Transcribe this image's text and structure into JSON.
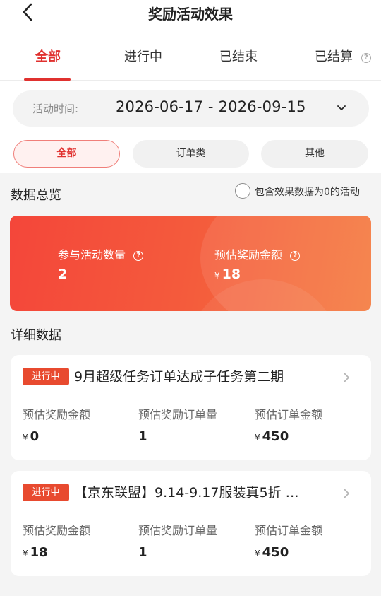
{
  "nav": {
    "title": "奖励活动效果"
  },
  "tabs": [
    {
      "label": "全部"
    },
    {
      "label": "进行中"
    },
    {
      "label": "已结束"
    },
    {
      "label": "已结算"
    }
  ],
  "date_filter": {
    "label": "活动时间:",
    "value": "2026-06-17 - 2026-09-15"
  },
  "type_filters": [
    {
      "label": "全部"
    },
    {
      "label": "订单类"
    },
    {
      "label": "其他"
    }
  ],
  "overview": {
    "title": "数据总览",
    "include_zero_label": "包含效果数据为0的活动",
    "metrics": [
      {
        "label": "参与活动数量",
        "value": "2"
      },
      {
        "label": "预估奖励金额",
        "currency": "¥",
        "value": "18"
      }
    ]
  },
  "details": {
    "title": "详细数据",
    "cards": [
      {
        "status": "进行中",
        "title": "9月超级任务订单达成子任务第二期",
        "metrics": [
          {
            "label": "预估奖励金额",
            "currency": "¥",
            "value": "0"
          },
          {
            "label": "预估奖励订单量",
            "value": "1"
          },
          {
            "label": "预估订单金额",
            "currency": "¥",
            "value": "450"
          }
        ]
      },
      {
        "status": "进行中",
        "title": "【京东联盟】9.14-9.17服装真5折 …",
        "metrics": [
          {
            "label": "预估奖励金额",
            "currency": "¥",
            "value": "18"
          },
          {
            "label": "预估奖励订单量",
            "value": "1"
          },
          {
            "label": "预估订单金额",
            "currency": "¥",
            "value": "450"
          }
        ]
      }
    ]
  },
  "icons": {
    "back": "chevron-left-icon",
    "dropdown": "chevron-down-icon",
    "help": "question-circle-icon",
    "card_arrow": "chevron-right-icon"
  },
  "colors": {
    "accent": "#e0312f",
    "badge": "#e84a2f",
    "summary_gradient_start": "#f4463a",
    "summary_gradient_end": "#f47a3e"
  }
}
